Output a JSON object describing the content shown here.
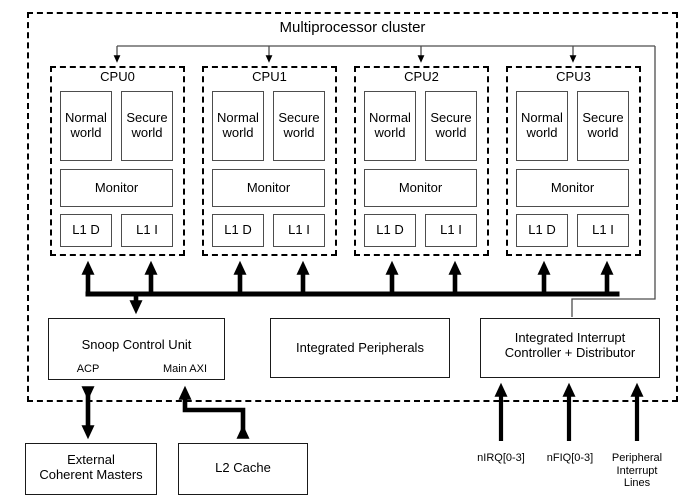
{
  "diagram": {
    "title": "Multiprocessor cluster",
    "cluster_label": "Multiprocessor cluster",
    "cpus": [
      {
        "name": "CPU0",
        "normal_world": "Normal\nworld",
        "secure_world": "Secure\nworld",
        "monitor": "Monitor",
        "l1_data": "L1 D",
        "l1_instruction": "L1 I"
      },
      {
        "name": "CPU1",
        "normal_world": "Normal\nworld",
        "secure_world": "Secure\nworld",
        "monitor": "Monitor",
        "l1_data": "L1 D",
        "l1_instruction": "L1 I"
      },
      {
        "name": "CPU2",
        "normal_world": "Normal\nworld",
        "secure_world": "Secure\nworld",
        "monitor": "Monitor",
        "l1_data": "L1 D",
        "l1_instruction": "L1 I"
      },
      {
        "name": "CPU3",
        "normal_world": "Normal\nworld",
        "secure_world": "Secure\nworld",
        "monitor": "Monitor",
        "l1_data": "L1 D",
        "l1_instruction": "L1 I"
      }
    ],
    "blocks": {
      "snoop_control_unit": "Snoop Control Unit",
      "snoop_port_acp": "ACP",
      "snoop_port_main_axi": "Main AXI",
      "integrated_peripherals": "Integrated Peripherals",
      "interrupt_controller": "Integrated Interrupt\nController + Distributor",
      "external_coherent_masters": "External\nCoherent Masters",
      "l2_cache": "L2 Cache"
    },
    "signals": {
      "nirq": "nIRQ[0-3]",
      "nfiq": "nFIQ[0-3]",
      "peripheral_interrupt_lines": "Peripheral\nInterrupt\nLines"
    },
    "colors": {
      "line": "#000000",
      "box_border": "#4d4d4d",
      "background": "#ffffff"
    }
  }
}
